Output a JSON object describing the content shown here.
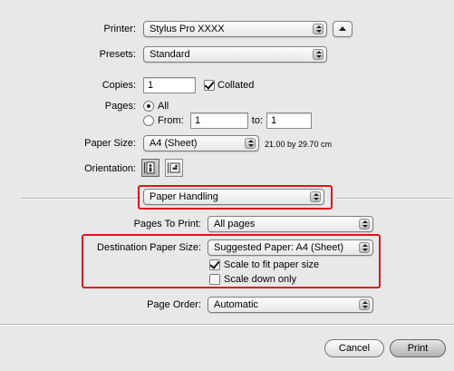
{
  "printer": {
    "label": "Printer:",
    "value": "Stylus Pro XXXX"
  },
  "presets": {
    "label": "Presets:",
    "value": "Standard"
  },
  "copies": {
    "label": "Copies:",
    "value": "1",
    "collated_label": "Collated",
    "collated": true
  },
  "pages": {
    "label": "Pages:",
    "all_label": "All",
    "from_label": "From:",
    "from_value": "1",
    "to_label": "to:",
    "to_value": "1",
    "selected": "All"
  },
  "paper_size": {
    "label": "Paper Size:",
    "value": "A4 (Sheet)",
    "dimensions": "21.00 by 29.70 cm"
  },
  "orientation": {
    "label": "Orientation:",
    "selected": "portrait"
  },
  "panel": {
    "value": "Paper Handling"
  },
  "pages_to_print": {
    "label": "Pages To Print:",
    "value": "All pages"
  },
  "destination": {
    "label": "Destination Paper Size:",
    "value": "Suggested Paper: A4 (Sheet)",
    "scale_fit_label": "Scale to fit paper size",
    "scale_fit": true,
    "scale_down_label": "Scale down only",
    "scale_down": false
  },
  "page_order": {
    "label": "Page Order:",
    "value": "Automatic"
  },
  "buttons": {
    "cancel": "Cancel",
    "print": "Print"
  },
  "colors": {
    "highlight": "#e0121a",
    "background": "#e8e8e8"
  }
}
